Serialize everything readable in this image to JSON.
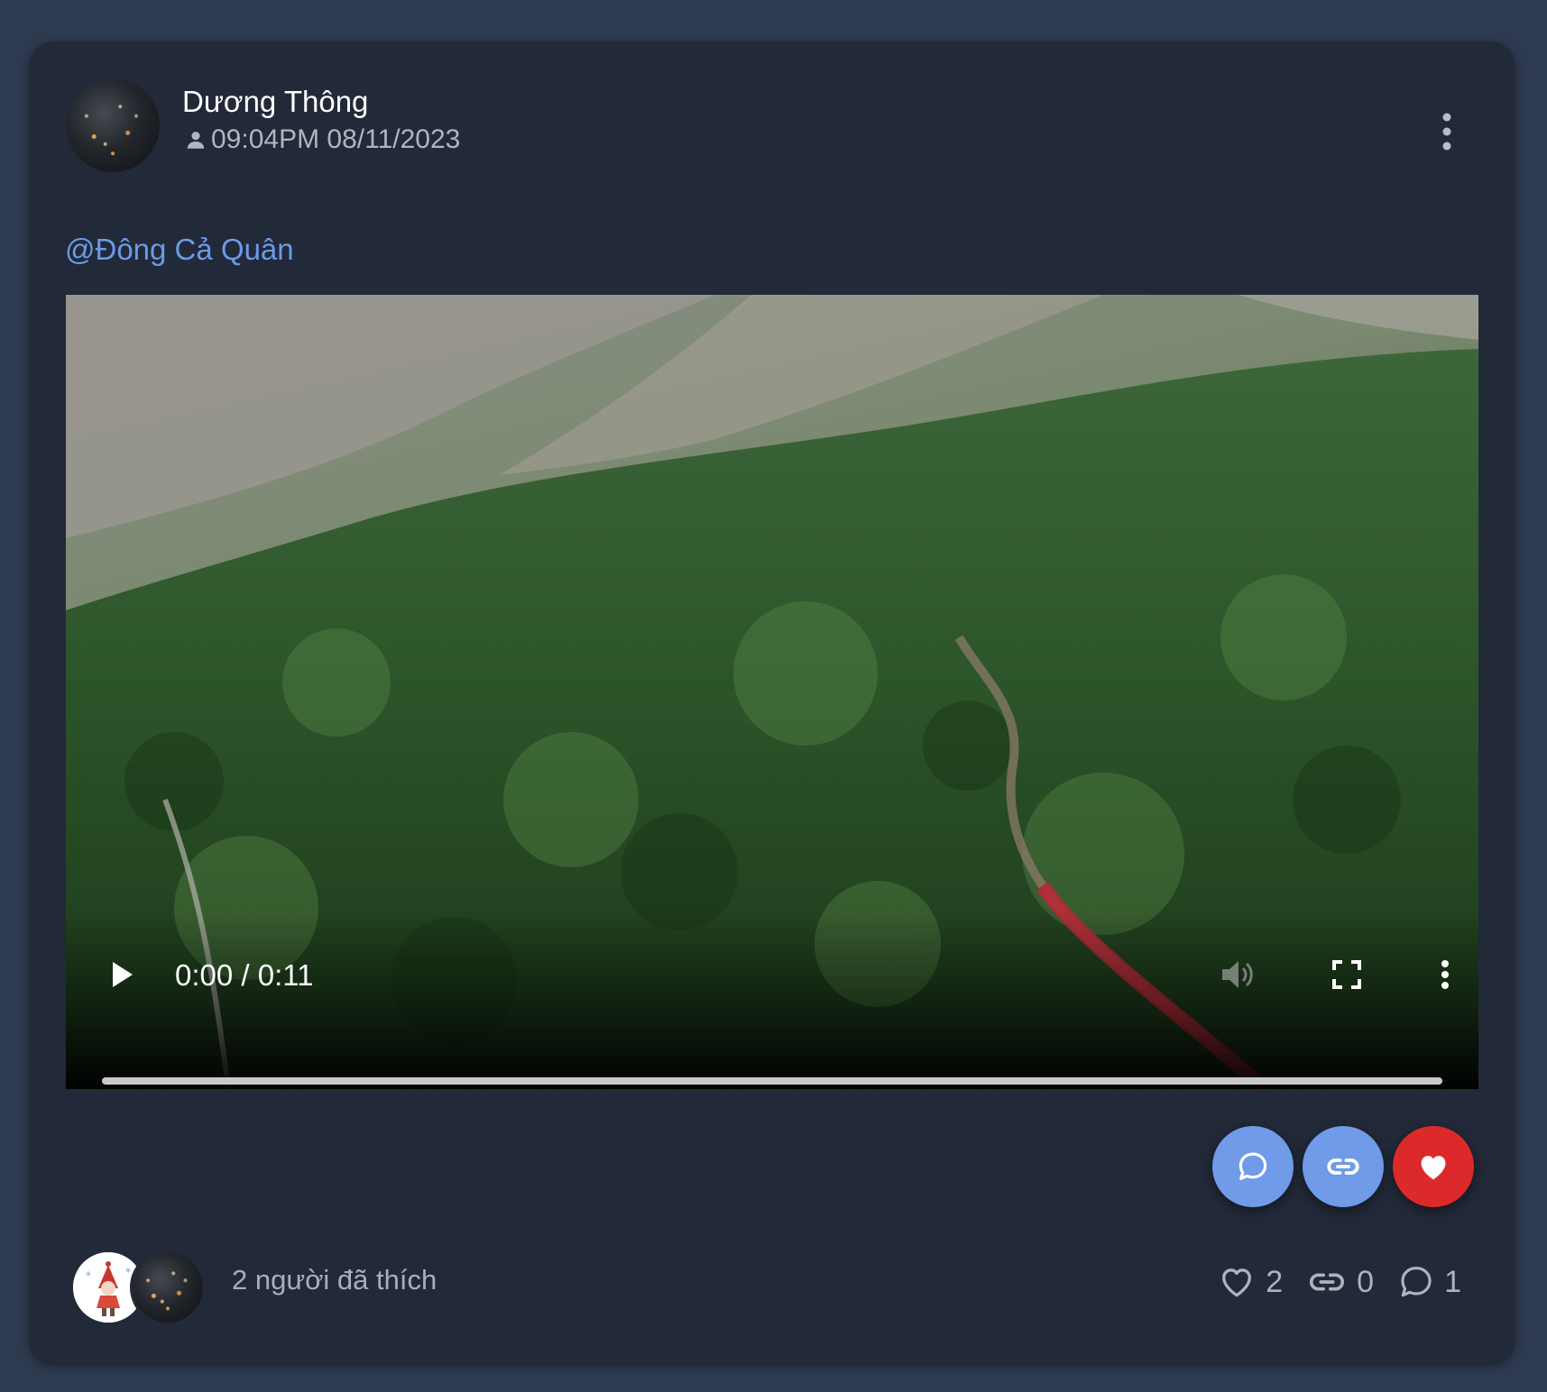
{
  "post": {
    "author_name": "Dương Thông",
    "timestamp": "09:04PM 08/11/2023",
    "mention": "@Đông Cả Quân"
  },
  "video": {
    "time_display": "0:00 / 0:11",
    "progress": 0.0
  },
  "footer": {
    "likes_text": "2 người đã thích",
    "like_count": "2",
    "share_count": "0",
    "comment_count": "1"
  },
  "colors": {
    "page_bg": "#2e3a4f",
    "card_bg": "#222938",
    "mention": "#6b9ae8",
    "action_blue": "#6f9be8",
    "action_red": "#dc2a2a"
  },
  "icons": {
    "more": "more-vertical-icon",
    "privacy": "person-icon",
    "play": "play-icon",
    "volume": "volume-icon",
    "fullscreen": "fullscreen-icon",
    "comment": "comment-bubble-icon",
    "link": "link-icon",
    "like": "heart-icon"
  }
}
